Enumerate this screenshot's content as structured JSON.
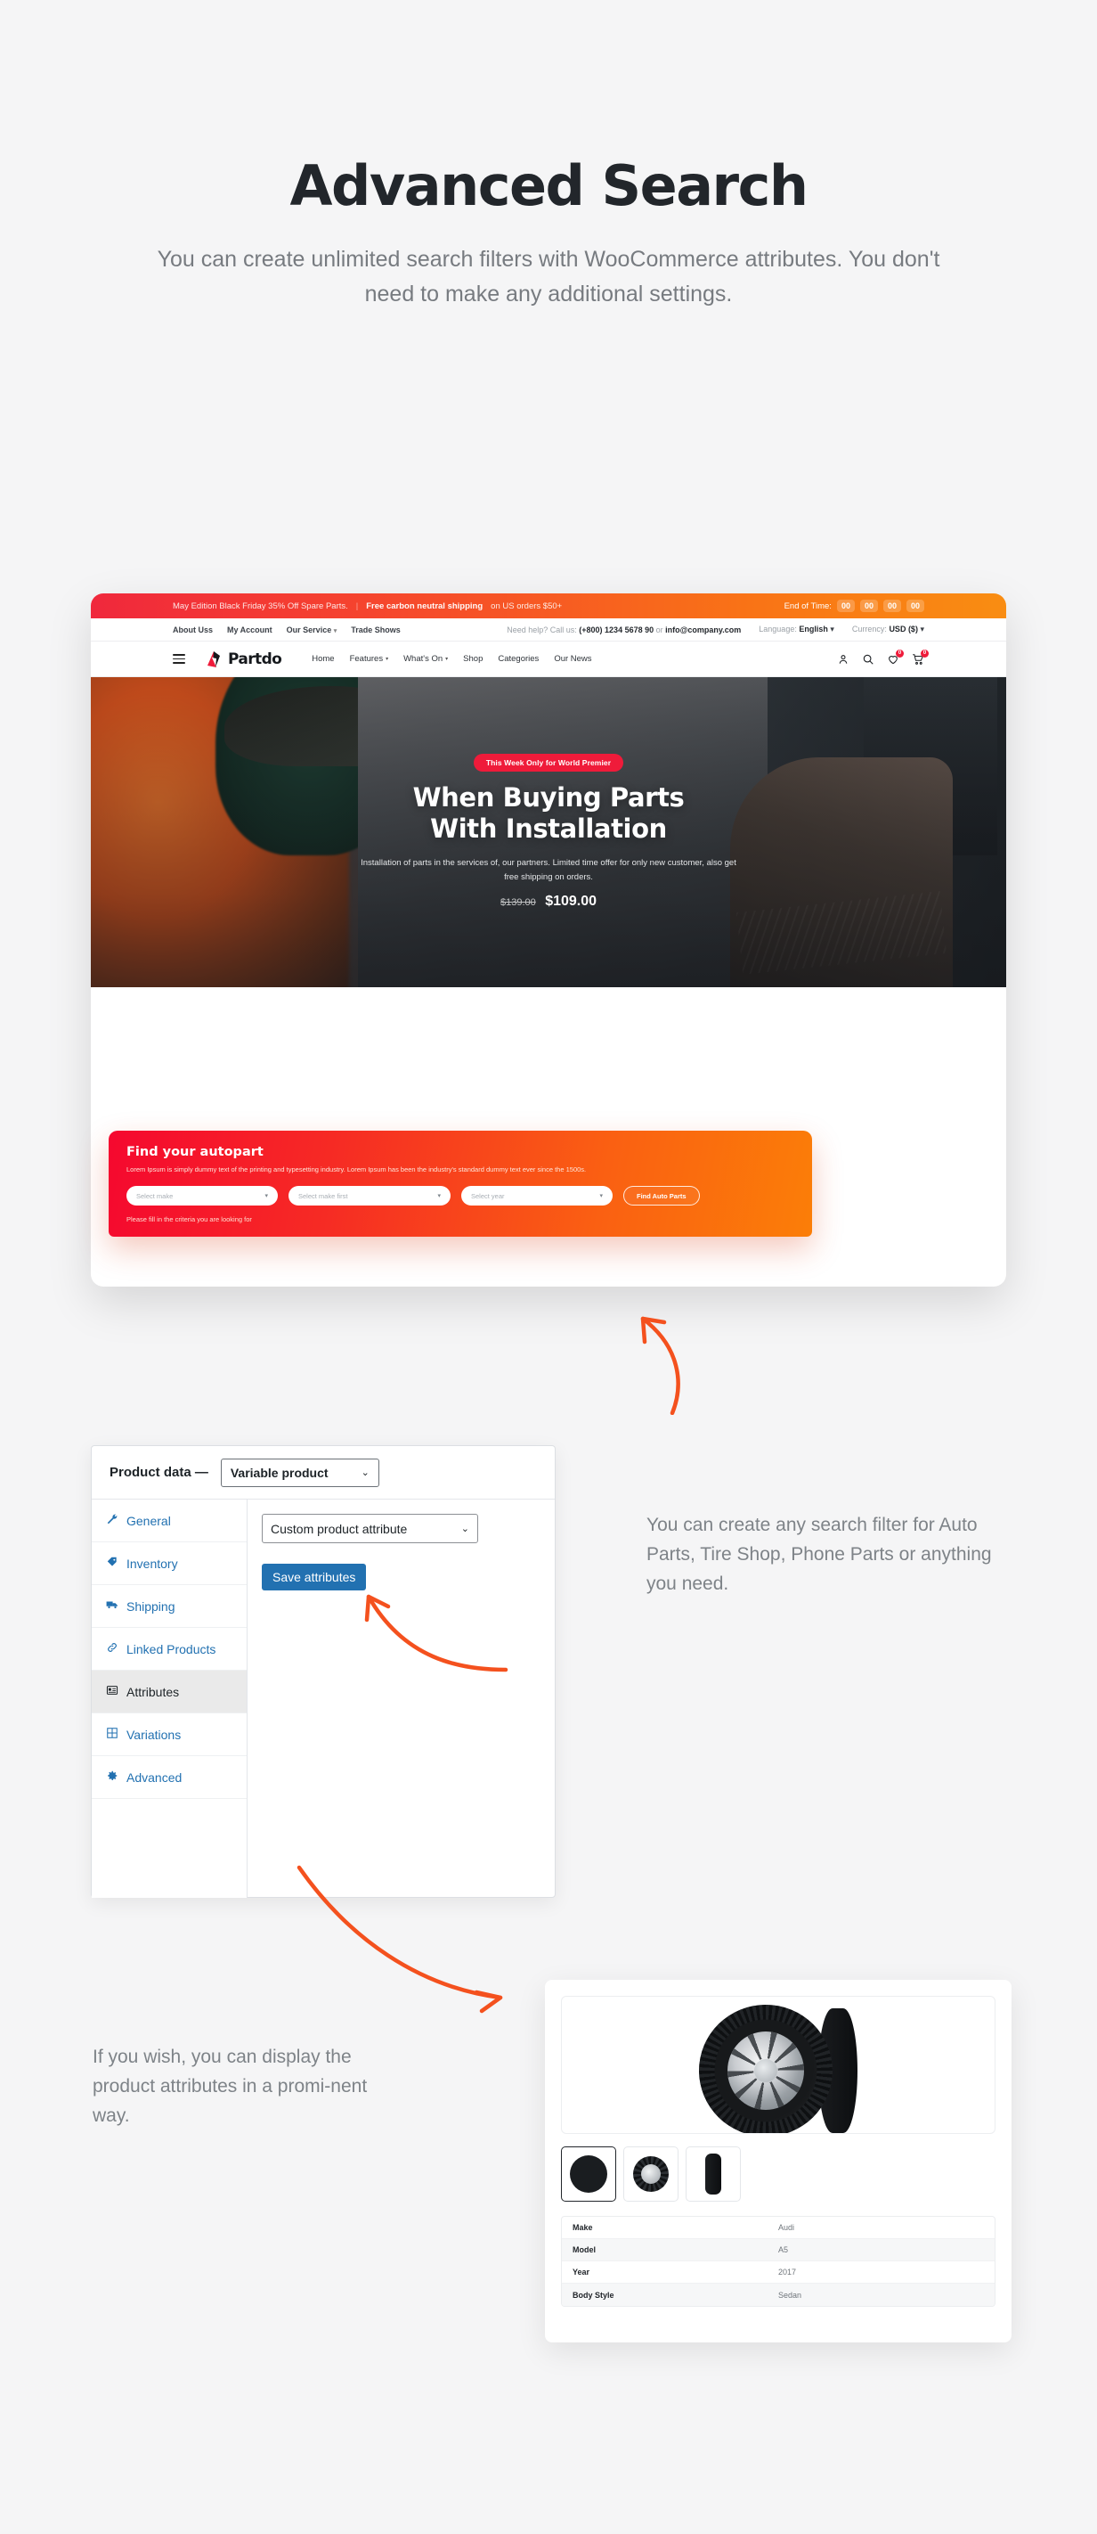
{
  "page": {
    "title": "Advanced Search",
    "subtitle": "You can create unlimited search filters with WooCommerce attributes. You don't need to  make any additional settings."
  },
  "site": {
    "topbar": {
      "promo_main": "May Edition Black Friday 35% Off Spare Parts.",
      "promo_bold": "Free carbon neutral shipping",
      "promo_tail": "on US orders $50+",
      "countdown_label": "End of Time:",
      "countdown": [
        "00",
        "00",
        "00",
        "00"
      ]
    },
    "utilbar": {
      "links": [
        "About Uss",
        "My Account",
        "Our Service",
        "Trade Shows"
      ],
      "help_label": "Need help? Call us:",
      "phone": "(+800) 1234 5678 90",
      "or": "or",
      "email": "info@company.com",
      "language_label": "Language:",
      "language_value": "English",
      "currency_label": "Currency:",
      "currency_value": "USD ($)"
    },
    "nav": {
      "brand": "Partdo",
      "links": [
        "Home",
        "Features",
        "What's On",
        "Shop",
        "Categories",
        "Our News"
      ],
      "wishlist_count": "0",
      "cart_count": "0"
    },
    "hero": {
      "pill": "This Week Only for World Premier",
      "title_line1": "When Buying Parts",
      "title_line2": "With Installation",
      "desc": "Installation of parts in the services of, our partners. Limited time offer for only new customer, also get free shipping on orders.",
      "price_old": "$139.00",
      "price_new": "$109.00"
    },
    "findbox": {
      "title": "Find your autopart",
      "lead": "Lorem Ipsum is simply dummy text of the printing and typesetting industry. Lorem Ipsum has been the industry's standard dummy text ever since the 1500s.",
      "select_make": "Select make",
      "select_model": "Select make first",
      "select_year": "Select year",
      "button": "Find Auto Parts",
      "note": "Please fill in the criteria you are looking for"
    }
  },
  "woocommerce": {
    "panel_label": "Product data —",
    "product_type": "Variable product",
    "tabs": [
      {
        "label": "General",
        "icon": "wrench-icon",
        "active": false
      },
      {
        "label": "Inventory",
        "icon": "tag-icon",
        "active": false
      },
      {
        "label": "Shipping",
        "icon": "truck-icon",
        "active": false
      },
      {
        "label": "Linked Products",
        "icon": "link-icon",
        "active": false
      },
      {
        "label": "Attributes",
        "icon": "list-icon",
        "active": true
      },
      {
        "label": "Variations",
        "icon": "grid-icon",
        "active": false
      },
      {
        "label": "Advanced",
        "icon": "gear-icon",
        "active": false
      }
    ],
    "attribute_select": "Custom product attribute",
    "save_button": "Save attributes"
  },
  "annotations": {
    "right_copy": "You can create any search filter for Auto Parts, Tire Shop, Phone Parts or anything you need.",
    "left_copy": "If you wish, you can display the product attributes in a promi-nent way."
  },
  "product_card": {
    "attributes": [
      {
        "key": "Make",
        "value": "Audi"
      },
      {
        "key": "Model",
        "value": "A5"
      },
      {
        "key": "Year",
        "value": "2017"
      },
      {
        "key": "Body Style",
        "value": "Sedan"
      }
    ]
  },
  "colors": {
    "accent_red": "#ef1b3a",
    "accent_orange": "#fb7e08",
    "arrow": "#f4511e",
    "woo_blue": "#2271b1",
    "page_bg": "#f5f5f6"
  }
}
